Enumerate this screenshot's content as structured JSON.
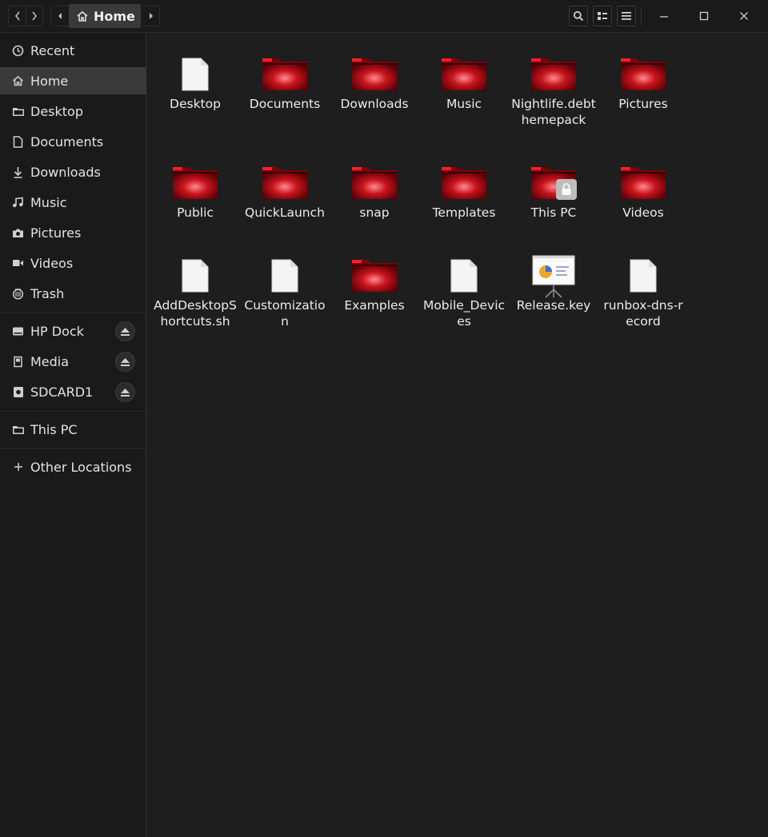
{
  "header": {
    "location": "Home"
  },
  "sidebar": {
    "places": [
      {
        "label": "Recent",
        "icon": "clock-icon"
      },
      {
        "label": "Home",
        "icon": "home-icon",
        "active": true
      },
      {
        "label": "Desktop",
        "icon": "folder-icon"
      },
      {
        "label": "Documents",
        "icon": "document-icon"
      },
      {
        "label": "Downloads",
        "icon": "download-icon"
      },
      {
        "label": "Music",
        "icon": "music-icon"
      },
      {
        "label": "Pictures",
        "icon": "camera-icon"
      },
      {
        "label": "Videos",
        "icon": "video-icon"
      },
      {
        "label": "Trash",
        "icon": "trash-icon"
      }
    ],
    "devices": [
      {
        "label": "HP Dock",
        "icon": "drive-icon"
      },
      {
        "label": "Media",
        "icon": "sdcard-icon"
      },
      {
        "label": "SDCARD1",
        "icon": "sdcard-icon"
      }
    ],
    "bookmarks": [
      {
        "label": "This PC",
        "icon": "folder-icon"
      }
    ],
    "other": {
      "label": "Other Locations",
      "icon": "plus-icon"
    }
  },
  "files": [
    {
      "name": "Desktop",
      "type": "file"
    },
    {
      "name": "Documents",
      "type": "folder"
    },
    {
      "name": "Downloads",
      "type": "folder"
    },
    {
      "name": "Music",
      "type": "folder"
    },
    {
      "name": "Nightlife.debthemepack",
      "type": "folder"
    },
    {
      "name": "Pictures",
      "type": "folder"
    },
    {
      "name": "Public",
      "type": "folder"
    },
    {
      "name": "QuickLaunch",
      "type": "folder"
    },
    {
      "name": "snap",
      "type": "folder"
    },
    {
      "name": "Templates",
      "type": "folder"
    },
    {
      "name": "This PC",
      "type": "folder-locked"
    },
    {
      "name": "Videos",
      "type": "folder"
    },
    {
      "name": "AddDesktopShortcuts.sh",
      "type": "file"
    },
    {
      "name": "Customization",
      "type": "file"
    },
    {
      "name": "Examples",
      "type": "folder"
    },
    {
      "name": "Mobile_Devices",
      "type": "file"
    },
    {
      "name": "Release.key",
      "type": "presentation"
    },
    {
      "name": "runbox-dns-record",
      "type": "file"
    }
  ],
  "colors": {
    "folder": "#c8141c",
    "background": "#1e1e1e",
    "sidebar": "#1a1a1a",
    "active": "#3a3a3a"
  }
}
